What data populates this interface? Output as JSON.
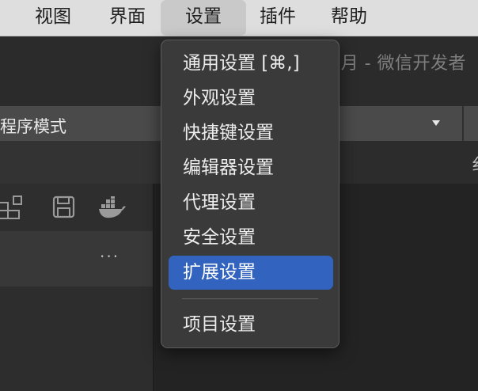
{
  "menubar": {
    "items": [
      {
        "label": "视图"
      },
      {
        "label": "界面"
      },
      {
        "label": "设置"
      },
      {
        "label": "插件"
      },
      {
        "label": "帮助"
      }
    ],
    "active_index": 2
  },
  "window": {
    "title_fragment": "j月 - 微信开发者"
  },
  "toolbar": {
    "mode_label": "程序模式",
    "right_text": "纟"
  },
  "sidebar": {
    "more_label": "···"
  },
  "settings_menu": {
    "items": [
      {
        "label": "通用设置 [⌘,]",
        "highlighted": false
      },
      {
        "label": "外观设置",
        "highlighted": false
      },
      {
        "label": "快捷键设置",
        "highlighted": false
      },
      {
        "label": "编辑器设置",
        "highlighted": false
      },
      {
        "label": "代理设置",
        "highlighted": false
      },
      {
        "label": "安全设置",
        "highlighted": false
      },
      {
        "label": "扩展设置",
        "highlighted": true
      },
      {
        "label": "项目设置",
        "highlighted": false
      }
    ]
  },
  "colors": {
    "menubar_bg": "#dedede",
    "menu_bg": "#3a3a3a",
    "highlight": "#3163bf"
  },
  "icons": [
    "layout-icon",
    "save-icon",
    "docker-icon",
    "dropdown-caret-icon"
  ]
}
